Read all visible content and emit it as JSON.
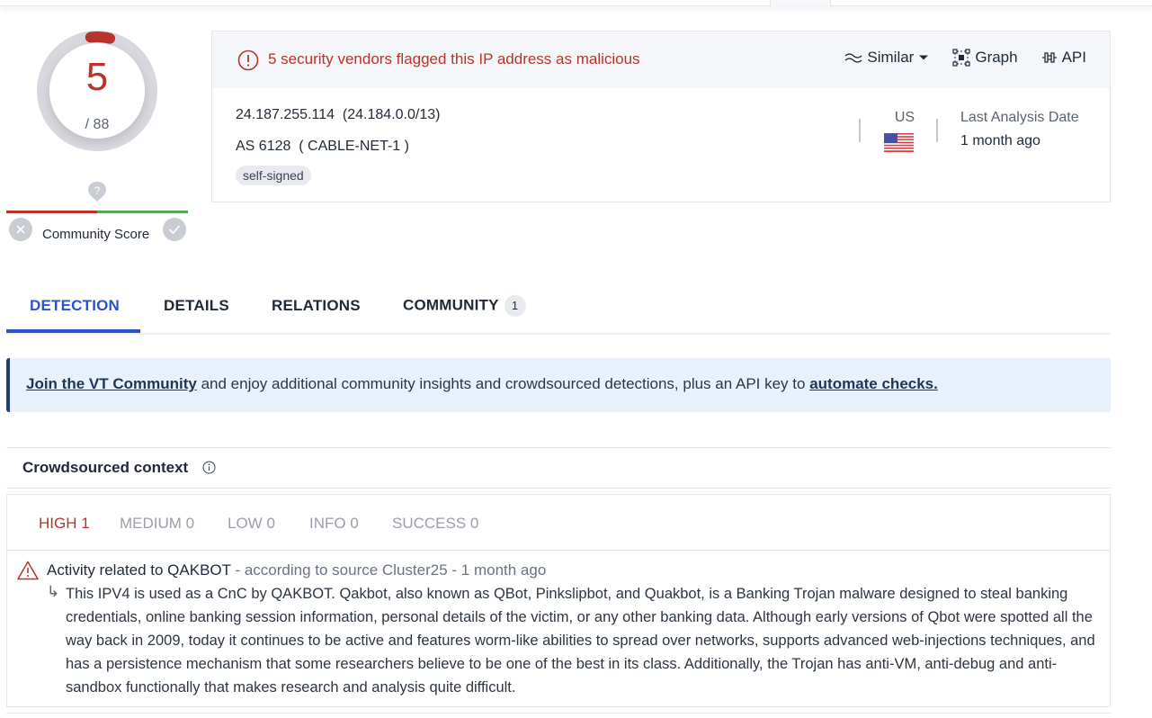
{
  "detection_gauge": {
    "score": "5",
    "total": "/ 88",
    "fraction": 0.0568,
    "color": "#b7332b"
  },
  "community_score": {
    "label": "Community Score",
    "pin_icon": "question-pin-icon",
    "downvote_icon": "close-icon",
    "upvote_icon": "check-icon"
  },
  "summary": {
    "alert_text": "5 security vendors flagged this IP address as malicious",
    "alert_icon": "alert-circle-icon",
    "actions": [
      {
        "label": "Similar",
        "icon": "similar-waves-icon",
        "dropdown": true
      },
      {
        "label": "Graph",
        "icon": "graph-icon"
      },
      {
        "label": "API",
        "icon": "api-icon"
      }
    ],
    "ip": "24.187.255.114  (24.184.0.0/13)",
    "as": "AS 6128  ( CABLE-NET-1 )",
    "tags": [
      "self-signed"
    ],
    "country": "US",
    "flag_icon": "us-flag-icon",
    "last_analysis_label": "Last Analysis Date",
    "last_analysis_value": "1 month ago"
  },
  "tabs": [
    {
      "label": "DETECTION",
      "active": true
    },
    {
      "label": "DETAILS"
    },
    {
      "label": "RELATIONS"
    },
    {
      "label": "COMMUNITY",
      "badge": "1"
    }
  ],
  "banner": {
    "link1": "Join the VT Community",
    "text": " and enjoy additional community insights and crowdsourced detections, plus an API key to ",
    "link2": "automate checks."
  },
  "crowdsourced": {
    "title": "Crowdsourced context",
    "severity_tabs": [
      {
        "label": "HIGH 1",
        "active": true
      },
      {
        "label": "MEDIUM 0"
      },
      {
        "label": "LOW 0"
      },
      {
        "label": "INFO 0"
      },
      {
        "label": "SUCCESS 0"
      }
    ],
    "detections": [
      {
        "title": "Activity related to QAKBOT",
        "meta": " - according to source Cluster25 - 1 month ago",
        "arrow": "↳",
        "description": "This IPV4 is used as a CnC by QAKBOT. Qakbot, also known as QBot, Pinkslipbot, and Quakbot, is a Banking Trojan malware designed to steal banking credentials, online banking session information, personal details of the victim, or any other banking data. Although early versions of Qbot were spotted all the way back in 2009, today it continues to be active and features worm-like abilities to spread over networks, supports advanced web-injections techniques, and has a persistence mechanism that some researchers believe to be one of the best in its class. Additionally, the Trojan has anti-VM, anti-debug and anti-sandbox functionally that makes research and analysis quite difficult."
      }
    ]
  }
}
